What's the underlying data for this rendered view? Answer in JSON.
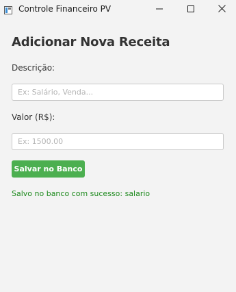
{
  "window": {
    "title": "Controle Financeiro PV",
    "icon": "java-app-icon",
    "controls": {
      "minimize_icon": "minimize-icon",
      "maximize_icon": "maximize-icon",
      "close_icon": "close-icon"
    }
  },
  "form": {
    "heading": "Adicionar Nova Receita",
    "description_label": "Descrição:",
    "description_value": "",
    "description_placeholder": "Ex: Salário, Venda...",
    "value_label": "Valor (R$):",
    "value_value": "",
    "value_placeholder": "Ex: 1500.00",
    "save_label": "Salvar no Banco",
    "status_message": "Salvo no banco com sucesso: salario"
  },
  "colors": {
    "background": "#f3f3f3",
    "save_button": "#4caf50",
    "status_text": "#1e8a1e",
    "heading_text": "#333333"
  }
}
